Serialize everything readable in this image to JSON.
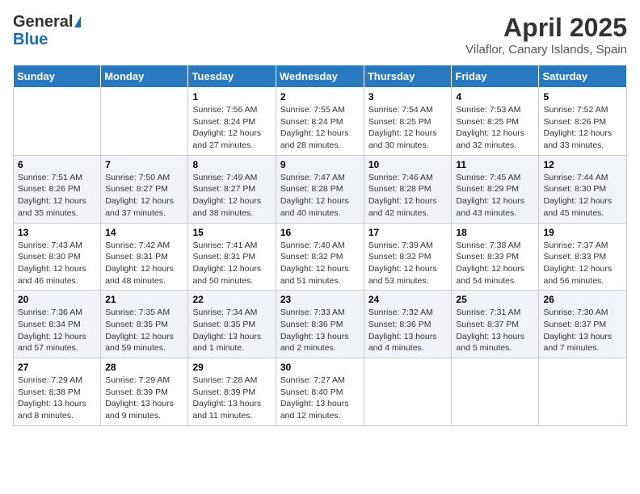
{
  "header": {
    "logo_general": "General",
    "logo_blue": "Blue",
    "month_title": "April 2025",
    "location": "Vilaflor, Canary Islands, Spain"
  },
  "days_of_week": [
    "Sunday",
    "Monday",
    "Tuesday",
    "Wednesday",
    "Thursday",
    "Friday",
    "Saturday"
  ],
  "weeks": [
    [
      null,
      null,
      {
        "day": 1,
        "sunrise": "7:56 AM",
        "sunset": "8:24 PM",
        "daylight": "12 hours and 27 minutes."
      },
      {
        "day": 2,
        "sunrise": "7:55 AM",
        "sunset": "8:24 PM",
        "daylight": "12 hours and 28 minutes."
      },
      {
        "day": 3,
        "sunrise": "7:54 AM",
        "sunset": "8:25 PM",
        "daylight": "12 hours and 30 minutes."
      },
      {
        "day": 4,
        "sunrise": "7:53 AM",
        "sunset": "8:25 PM",
        "daylight": "12 hours and 32 minutes."
      },
      {
        "day": 5,
        "sunrise": "7:52 AM",
        "sunset": "8:26 PM",
        "daylight": "12 hours and 33 minutes."
      }
    ],
    [
      {
        "day": 6,
        "sunrise": "7:51 AM",
        "sunset": "8:26 PM",
        "daylight": "12 hours and 35 minutes."
      },
      {
        "day": 7,
        "sunrise": "7:50 AM",
        "sunset": "8:27 PM",
        "daylight": "12 hours and 37 minutes."
      },
      {
        "day": 8,
        "sunrise": "7:49 AM",
        "sunset": "8:27 PM",
        "daylight": "12 hours and 38 minutes."
      },
      {
        "day": 9,
        "sunrise": "7:47 AM",
        "sunset": "8:28 PM",
        "daylight": "12 hours and 40 minutes."
      },
      {
        "day": 10,
        "sunrise": "7:46 AM",
        "sunset": "8:28 PM",
        "daylight": "12 hours and 42 minutes."
      },
      {
        "day": 11,
        "sunrise": "7:45 AM",
        "sunset": "8:29 PM",
        "daylight": "12 hours and 43 minutes."
      },
      {
        "day": 12,
        "sunrise": "7:44 AM",
        "sunset": "8:30 PM",
        "daylight": "12 hours and 45 minutes."
      }
    ],
    [
      {
        "day": 13,
        "sunrise": "7:43 AM",
        "sunset": "8:30 PM",
        "daylight": "12 hours and 46 minutes."
      },
      {
        "day": 14,
        "sunrise": "7:42 AM",
        "sunset": "8:31 PM",
        "daylight": "12 hours and 48 minutes."
      },
      {
        "day": 15,
        "sunrise": "7:41 AM",
        "sunset": "8:31 PM",
        "daylight": "12 hours and 50 minutes."
      },
      {
        "day": 16,
        "sunrise": "7:40 AM",
        "sunset": "8:32 PM",
        "daylight": "12 hours and 51 minutes."
      },
      {
        "day": 17,
        "sunrise": "7:39 AM",
        "sunset": "8:32 PM",
        "daylight": "12 hours and 53 minutes."
      },
      {
        "day": 18,
        "sunrise": "7:38 AM",
        "sunset": "8:33 PM",
        "daylight": "12 hours and 54 minutes."
      },
      {
        "day": 19,
        "sunrise": "7:37 AM",
        "sunset": "8:33 PM",
        "daylight": "12 hours and 56 minutes."
      }
    ],
    [
      {
        "day": 20,
        "sunrise": "7:36 AM",
        "sunset": "8:34 PM",
        "daylight": "12 hours and 57 minutes."
      },
      {
        "day": 21,
        "sunrise": "7:35 AM",
        "sunset": "8:35 PM",
        "daylight": "12 hours and 59 minutes."
      },
      {
        "day": 22,
        "sunrise": "7:34 AM",
        "sunset": "8:35 PM",
        "daylight": "13 hours and 1 minute."
      },
      {
        "day": 23,
        "sunrise": "7:33 AM",
        "sunset": "8:36 PM",
        "daylight": "13 hours and 2 minutes."
      },
      {
        "day": 24,
        "sunrise": "7:32 AM",
        "sunset": "8:36 PM",
        "daylight": "13 hours and 4 minutes."
      },
      {
        "day": 25,
        "sunrise": "7:31 AM",
        "sunset": "8:37 PM",
        "daylight": "13 hours and 5 minutes."
      },
      {
        "day": 26,
        "sunrise": "7:30 AM",
        "sunset": "8:37 PM",
        "daylight": "13 hours and 7 minutes."
      }
    ],
    [
      {
        "day": 27,
        "sunrise": "7:29 AM",
        "sunset": "8:38 PM",
        "daylight": "13 hours and 8 minutes."
      },
      {
        "day": 28,
        "sunrise": "7:29 AM",
        "sunset": "8:39 PM",
        "daylight": "13 hours and 9 minutes."
      },
      {
        "day": 29,
        "sunrise": "7:28 AM",
        "sunset": "8:39 PM",
        "daylight": "13 hours and 11 minutes."
      },
      {
        "day": 30,
        "sunrise": "7:27 AM",
        "sunset": "8:40 PM",
        "daylight": "13 hours and 12 minutes."
      },
      null,
      null,
      null
    ]
  ]
}
